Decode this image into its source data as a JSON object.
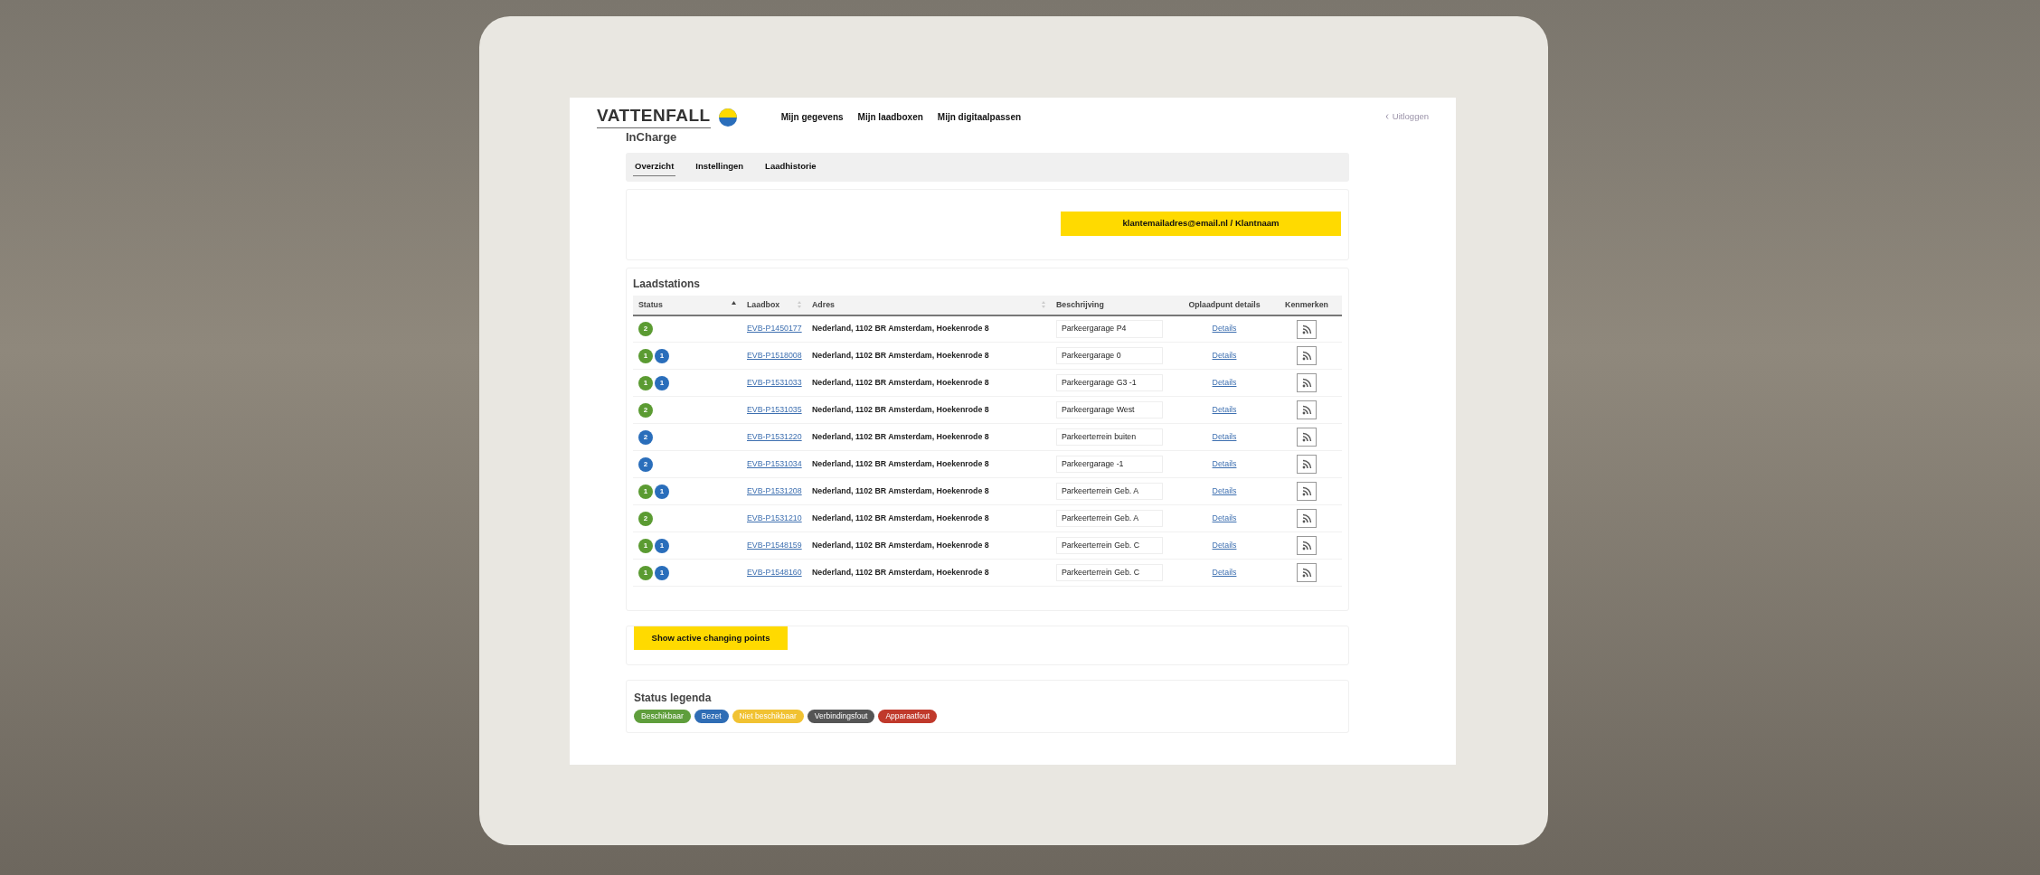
{
  "brand": {
    "name": "VATTENFALL",
    "product": "InCharge"
  },
  "nav": [
    "Mijn gegevens",
    "Mijn laadboxen",
    "Mijn digitaalpassen"
  ],
  "logout": "Uitloggen",
  "tabs": [
    {
      "label": "Overzicht",
      "selected": true
    },
    {
      "label": "Instellingen",
      "selected": false
    },
    {
      "label": "Laadhistorie",
      "selected": false
    }
  ],
  "account_button": "klantemailadres@email.nl / Klantnaam",
  "stations": {
    "title": "Laadstations",
    "columns": [
      {
        "label": "Status",
        "sorted": true
      },
      {
        "label": "Laadbox",
        "sorted": false
      },
      {
        "label": "Adres",
        "sorted": false
      },
      {
        "label": "Beschrijving"
      },
      {
        "label": "Oplaadpunt details"
      },
      {
        "label": "Kenmerken"
      }
    ],
    "rows": [
      {
        "status": [
          {
            "count": "2",
            "color": "#5b9b32"
          }
        ],
        "laadbox": "EVB-P1450177",
        "adres": "Nederland, 1102 BR Amsterdam, Hoekenrode 8",
        "beschrijving": "Parkeergarage P4",
        "details": "Details"
      },
      {
        "status": [
          {
            "count": "1",
            "color": "#5b9b32"
          },
          {
            "count": "1",
            "color": "#2a6ebb"
          }
        ],
        "laadbox": "EVB-P1518008",
        "adres": "Nederland, 1102 BR Amsterdam, Hoekenrode 8",
        "beschrijving": "Parkeergarage 0",
        "details": "Details"
      },
      {
        "status": [
          {
            "count": "1",
            "color": "#5b9b32"
          },
          {
            "count": "1",
            "color": "#2a6ebb"
          }
        ],
        "laadbox": "EVB-P1531033",
        "adres": "Nederland, 1102 BR Amsterdam, Hoekenrode 8",
        "beschrijving": "Parkeergarage G3 -1",
        "details": "Details"
      },
      {
        "status": [
          {
            "count": "2",
            "color": "#5b9b32"
          }
        ],
        "laadbox": "EVB-P1531035",
        "adres": "Nederland, 1102 BR Amsterdam, Hoekenrode 8",
        "beschrijving": "Parkeergarage West",
        "details": "Details"
      },
      {
        "status": [
          {
            "count": "2",
            "color": "#2a6ebb"
          }
        ],
        "laadbox": "EVB-P1531220",
        "adres": "Nederland, 1102 BR Amsterdam, Hoekenrode 8",
        "beschrijving": "Parkeerterrein buiten",
        "details": "Details"
      },
      {
        "status": [
          {
            "count": "2",
            "color": "#2a6ebb"
          }
        ],
        "laadbox": "EVB-P1531034",
        "adres": "Nederland, 1102 BR Amsterdam, Hoekenrode 8",
        "beschrijving": "Parkeergarage -1",
        "details": "Details"
      },
      {
        "status": [
          {
            "count": "1",
            "color": "#5b9b32"
          },
          {
            "count": "1",
            "color": "#2a6ebb"
          }
        ],
        "laadbox": "EVB-P1531208",
        "adres": "Nederland, 1102 BR Amsterdam, Hoekenrode 8",
        "beschrijving": "Parkeerterrein Geb. A",
        "details": "Details"
      },
      {
        "status": [
          {
            "count": "2",
            "color": "#5b9b32"
          }
        ],
        "laadbox": "EVB-P1531210",
        "adres": "Nederland, 1102 BR Amsterdam, Hoekenrode 8",
        "beschrijving": "Parkeerterrein Geb. A",
        "details": "Details"
      },
      {
        "status": [
          {
            "count": "1",
            "color": "#5b9b32"
          },
          {
            "count": "1",
            "color": "#2a6ebb"
          }
        ],
        "laadbox": "EVB-P1548159",
        "adres": "Nederland, 1102 BR Amsterdam, Hoekenrode 8",
        "beschrijving": "Parkeerterrein Geb. C",
        "details": "Details"
      },
      {
        "status": [
          {
            "count": "1",
            "color": "#5b9b32"
          },
          {
            "count": "1",
            "color": "#2a6ebb"
          }
        ],
        "laadbox": "EVB-P1548160",
        "adres": "Nederland, 1102 BR Amsterdam, Hoekenrode 8",
        "beschrijving": "Parkeerterrein Geb. C",
        "details": "Details"
      }
    ]
  },
  "show_active_button": "Show active changing points",
  "legend": {
    "title": "Status legenda",
    "items": [
      {
        "label": "Beschikbaar",
        "color": "#5f9e3c"
      },
      {
        "label": "Bezet",
        "color": "#2f6db5"
      },
      {
        "label": "Niet beschikbaar",
        "color": "#f1c232"
      },
      {
        "label": "Verbindingsfout",
        "color": "#555555"
      },
      {
        "label": "Apparaatfout",
        "color": "#c0392b"
      }
    ]
  }
}
